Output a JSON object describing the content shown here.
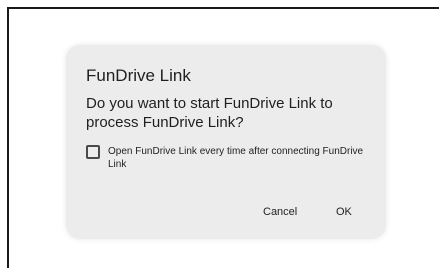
{
  "dialog": {
    "title": "FunDrive Link",
    "message": "Do you want to start FunDrive Link to process FunDrive Link?",
    "checkbox": {
      "label": "Open FunDrive Link every time after connecting FunDrive Link",
      "checked": false
    },
    "buttons": {
      "cancel_label": "Cancel",
      "ok_label": "OK"
    }
  },
  "colors": {
    "dialog_background": "#ececec",
    "text": "#1f1f1f",
    "page_background": "#ffffff"
  }
}
